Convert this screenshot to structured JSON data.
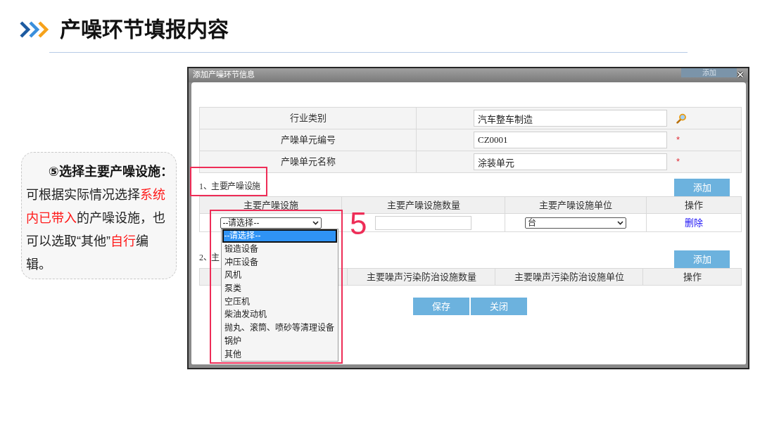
{
  "slide": {
    "title": "产噪环节填报内容"
  },
  "callout": {
    "heading": "⑤选择主要产噪设施：",
    "body": [
      {
        "text": "可根据实际情况选择",
        "highlight": false
      },
      {
        "text": "系统内已带入",
        "highlight": true
      },
      {
        "text": "的产噪设施，也可以选取“其他”",
        "highlight": false
      },
      {
        "text": "自行",
        "highlight": true
      },
      {
        "text": "编辑。",
        "highlight": false
      }
    ]
  },
  "dialog": {
    "title": "添加产噪环节信息",
    "behind_button": "添加",
    "form": [
      {
        "label": "行业类别",
        "value": "汽车整车制造",
        "kind": "lookup"
      },
      {
        "label": "产噪单元编号",
        "value": "CZ0001",
        "kind": "required",
        "marker": "*"
      },
      {
        "label": "产噪单元名称",
        "value": "涂装单元",
        "kind": "required",
        "marker": "*"
      }
    ],
    "sections": [
      {
        "label": "1、主要产噪设施",
        "highlighted": true,
        "add_button": "添加",
        "columns": [
          {
            "label": "主要产噪设施"
          },
          {
            "label": "主要产噪设施数量"
          },
          {
            "label": "主要产噪设施单位"
          },
          {
            "label": "操作"
          }
        ],
        "rows": [
          [
            {
              "kind": "select",
              "value": "--请选择--",
              "open": true,
              "highlighted": true,
              "step_label": "5",
              "options": [
                {
                  "label": "--请选择--",
                  "selected": true
                },
                {
                  "label": "锻造设备",
                  "selected": false
                },
                {
                  "label": "冲压设备",
                  "selected": false
                },
                {
                  "label": "风机",
                  "selected": false
                },
                {
                  "label": "泵类",
                  "selected": false
                },
                {
                  "label": "空压机",
                  "selected": false
                },
                {
                  "label": "柴油发动机",
                  "selected": false
                },
                {
                  "label": "抛丸、滚筒、喷砂等清理设备",
                  "selected": false
                },
                {
                  "label": "锅炉",
                  "selected": false
                },
                {
                  "label": "其他",
                  "selected": false
                }
              ]
            },
            {
              "kind": "input"
            },
            {
              "kind": "select",
              "value": "台",
              "open": false,
              "highlighted": false
            },
            {
              "kind": "link",
              "value": "删除"
            }
          ]
        ]
      },
      {
        "label": "2、主",
        "highlighted": false,
        "add_button": "添加",
        "columns": [
          {},
          {
            "label": "主要噪声污染防治设施数量"
          },
          {
            "label": "主要噪声污染防治设施单位"
          },
          {
            "label": "操作"
          }
        ]
      }
    ],
    "buttons": [
      "保存",
      "关闭"
    ]
  }
}
